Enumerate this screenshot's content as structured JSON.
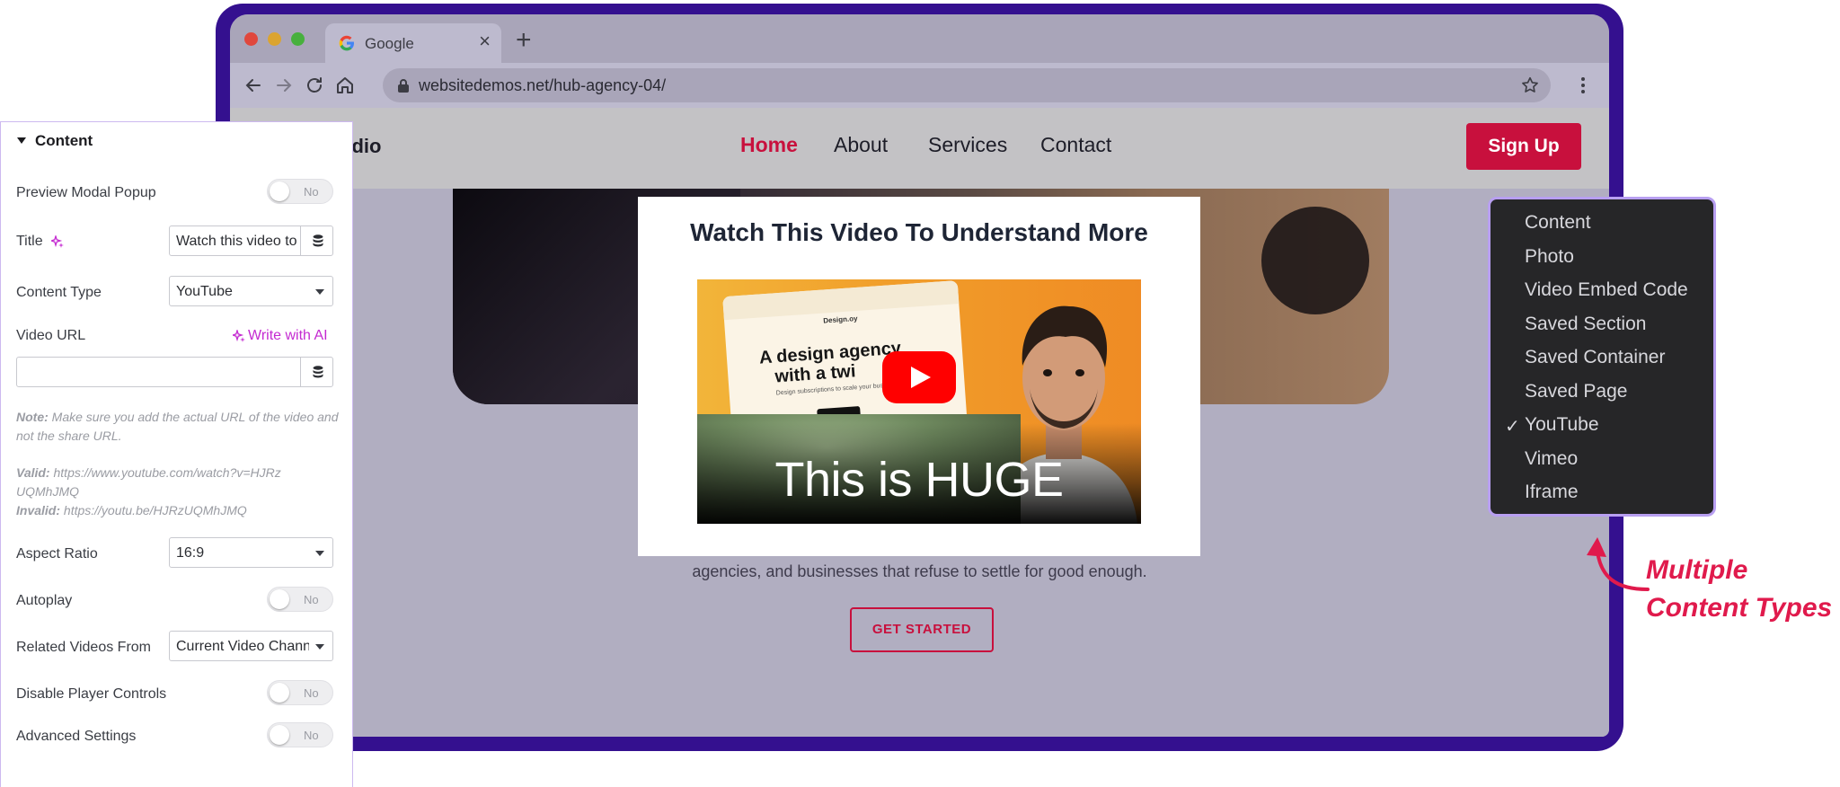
{
  "browser": {
    "tab_title": "Google",
    "tab_close": "×",
    "new_tab": "+",
    "url": "websitedemos.net/hub-agency-04/"
  },
  "site": {
    "brand_partial": "udio",
    "nav": [
      "Home",
      "About",
      "Services",
      "Contact"
    ],
    "nav_active": "Home",
    "signup_label": "Sign Up",
    "hero_text": "agencies, and businesses that refuse to settle for good enough.",
    "cta_label": "GET STARTED"
  },
  "modal": {
    "title": "Watch This Video To Understand More",
    "video": {
      "logo": "Design.oy",
      "headline_line1": "A design agency",
      "headline_line2": "with a twi",
      "subtext": "Design subscriptions to scale your business",
      "caption": "This is HUGE"
    }
  },
  "panel": {
    "section_title": "Content",
    "preview_modal_label": "Preview Modal Popup",
    "preview_modal_value": "No",
    "title_label": "Title",
    "title_value": "Watch this video to",
    "content_type_label": "Content Type",
    "content_type_value": "YouTube",
    "video_url_label": "Video URL",
    "write_ai_label": "Write with AI",
    "video_url_value": "",
    "note_label": "Note:",
    "note_text": "Make sure you add the actual URL of the video and not the share URL.",
    "valid_label": "Valid:",
    "valid_text": "https://www.youtube.com/watch?v=HJRzUQMhJMQ",
    "invalid_label": "Invalid:",
    "invalid_text": "https://youtu.be/HJRzUQMhJMQ",
    "aspect_ratio_label": "Aspect Ratio",
    "aspect_ratio_value": "16:9",
    "autoplay_label": "Autoplay",
    "autoplay_value": "No",
    "related_videos_label": "Related Videos From",
    "related_videos_value": "Current Video Channel",
    "disable_controls_label": "Disable Player Controls",
    "disable_controls_value": "No",
    "advanced_label": "Advanced Settings",
    "advanced_value": "No"
  },
  "dropdown": {
    "items": [
      "Content",
      "Photo",
      "Video Embed Code",
      "Saved Section",
      "Saved Container",
      "Saved Page",
      "YouTube",
      "Vimeo",
      "Iframe"
    ],
    "selected": "YouTube",
    "check": "✓"
  },
  "annotation": {
    "line1": "Multiple",
    "line2": "Content Types"
  },
  "colors": {
    "frame": "#34108f",
    "accent_red": "#c8103d",
    "annotation": "#e01a4c",
    "ai_purple": "#c42ad1",
    "dropdown_border": "#b89ff1"
  }
}
